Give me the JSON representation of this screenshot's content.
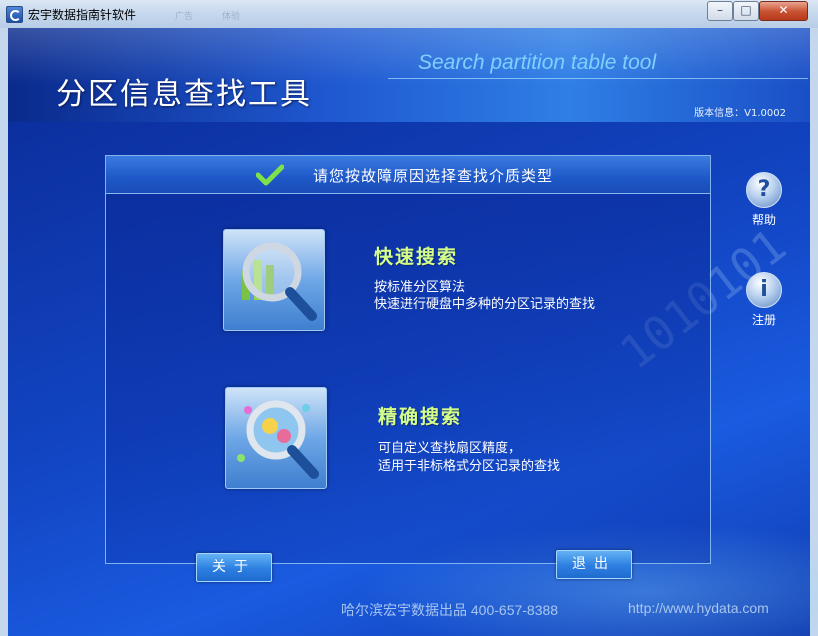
{
  "window": {
    "title": "宏宇数据指南针软件",
    "ghost_1": "广告",
    "ghost_2": "体验"
  },
  "banner": {
    "title": "分区信息查找工具",
    "subtitle": "Search partition table tool",
    "version": "版本信息：V1.0002"
  },
  "panel": {
    "heading": "请您按故障原因选择查找介质类型"
  },
  "options": [
    {
      "title": "快速搜索",
      "desc_1": "按标准分区算法",
      "desc_2": "快速进行硬盘中多种的分区记录的查找",
      "icon": "magnifier-chart-icon"
    },
    {
      "title": "精确搜索",
      "desc_1": "可自定义查找扇区精度，",
      "desc_2": "适用于非标格式分区记录的查找",
      "icon": "magnifier-globe-icon"
    }
  ],
  "side": {
    "help": "帮助",
    "register": "注册"
  },
  "buttons": {
    "about": "关于",
    "exit": "退出"
  },
  "footer": {
    "company": "哈尔滨宏宇数据出品  400-657-8388",
    "url": "http://www.hydata.com"
  },
  "colors": {
    "accent": "#1f58d0",
    "title_green": "#d6ff8a"
  }
}
